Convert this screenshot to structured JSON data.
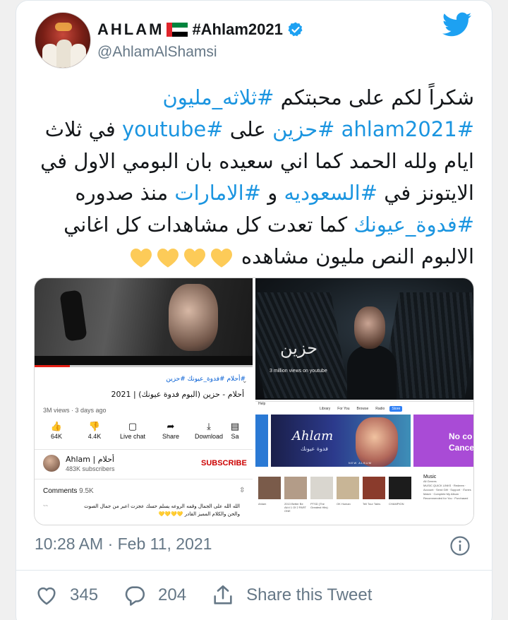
{
  "colors": {
    "link": "#1b95e0",
    "text": "#14171a",
    "muted": "#657786",
    "twitter_blue": "#1da1f2",
    "heart_emoji": "#fdcb58"
  },
  "user": {
    "display_name": "AHLAM",
    "name_hashtag": "#Ahlam2021",
    "handle": "@AhlamAlShamsi",
    "verified": true,
    "flag": "uae-flag"
  },
  "tweet": {
    "lines": [
      {
        "parts": [
          {
            "text": "شكراً لكم على محبتكم ",
            "type": "text"
          },
          {
            "text": "#ثلاثه_مليون",
            "type": "hashtag"
          }
        ]
      },
      {
        "parts": [
          {
            "text": "#ahlam2021",
            "type": "hashtag"
          },
          {
            "text": " ",
            "type": "text"
          },
          {
            "text": "#حزين",
            "type": "hashtag"
          },
          {
            "text": " على ",
            "type": "text"
          },
          {
            "text": "#youtube",
            "type": "hashtag"
          },
          {
            "text": "  في ثلاث",
            "type": "text"
          }
        ]
      },
      {
        "parts": [
          {
            "text": "ايام  ولله الحمد كما اني سعيده بان البومي الاول في",
            "type": "text"
          }
        ]
      },
      {
        "parts": [
          {
            "text": "الايتونز في ",
            "type": "text"
          },
          {
            "text": "#السعوديه",
            "type": "hashtag"
          },
          {
            "text": " و ",
            "type": "text"
          },
          {
            "text": "#الامارات",
            "type": "hashtag"
          },
          {
            "text": " منذ صدوره",
            "type": "text"
          }
        ]
      },
      {
        "parts": [
          {
            "text": "#فدوة_عيونك",
            "type": "hashtag"
          },
          {
            "text": "  كما تعدت كل مشاهدات كل اغاني",
            "type": "text"
          }
        ]
      },
      {
        "parts": [
          {
            "text": "الالبوم النص مليون مشاهده ",
            "type": "text"
          }
        ],
        "hearts": 4
      }
    ]
  },
  "media": {
    "youtube": {
      "hashtags": "#أحلام #فدوة_عيونك #حزين",
      "title": "أحلام - حزين (البوم فدوة عيونك) | 2021",
      "meta": "3M views · 3 days ago",
      "actions": [
        {
          "icon": "thumbs-up-icon",
          "label": "64K"
        },
        {
          "icon": "thumbs-down-icon",
          "label": "4.4K"
        },
        {
          "icon": "live-chat-icon",
          "label": "Live chat"
        },
        {
          "icon": "share-icon",
          "label": "Share"
        },
        {
          "icon": "download-icon",
          "label": "Download"
        },
        {
          "icon": "save-icon",
          "label": "Sa"
        }
      ],
      "channel_name": "Ahlam | أحلام",
      "channel_subs": "483K subscribers",
      "subscribe": "SUBSCRIBE",
      "comments_label": "Comments",
      "comments_count": "9.5K",
      "top_comment": "الله الله على الجمال وقمه الروعه يسلم حسك عجزت اعبر من جمال الصوت والحن والكلام المميز القادر 💛💛💛💛"
    },
    "promo": {
      "title": "حزين",
      "subtitle": "3 million views on youtube"
    },
    "itunes": {
      "help": "Help",
      "nav": [
        "Library",
        "For You",
        "Browse",
        "Radio",
        "Store"
      ],
      "active_nav": "Store",
      "banner_logo": "Ahlam",
      "banner_logo_ar": "فدوة عيونك",
      "banner_tag": "NEW ALBUM",
      "promo_text_1": "No co",
      "promo_text_2": "Cance",
      "albums": [
        {
          "label": "Ahlam",
          "color": "#7a5b4a"
        },
        {
          "label": "2013 Better Be Ak'd 1 Of 2 PART ONE",
          "color": "#b39c88"
        },
        {
          "label": "PTSD (The Greatest Hits)",
          "color": "#d9d6cf"
        },
        {
          "label": "OK Human",
          "color": "#c8b596"
        },
        {
          "label": "Tell Tour Tales",
          "color": "#8a3b2c"
        },
        {
          "label": "CHAMPION",
          "color": "#1c1c1c"
        }
      ],
      "side_title": "Music",
      "side_sub": "All Genres",
      "side_links": "MUSIC QUICK LINKS · Redeem · Account · Send Gift · Support · iTunes Match · Complete My Album · Recommended for You · Purchased"
    }
  },
  "timestamp": "10:28 AM · Feb 11, 2021",
  "engagement": {
    "likes": "345",
    "replies": "204",
    "share_label": "Share this Tweet"
  }
}
